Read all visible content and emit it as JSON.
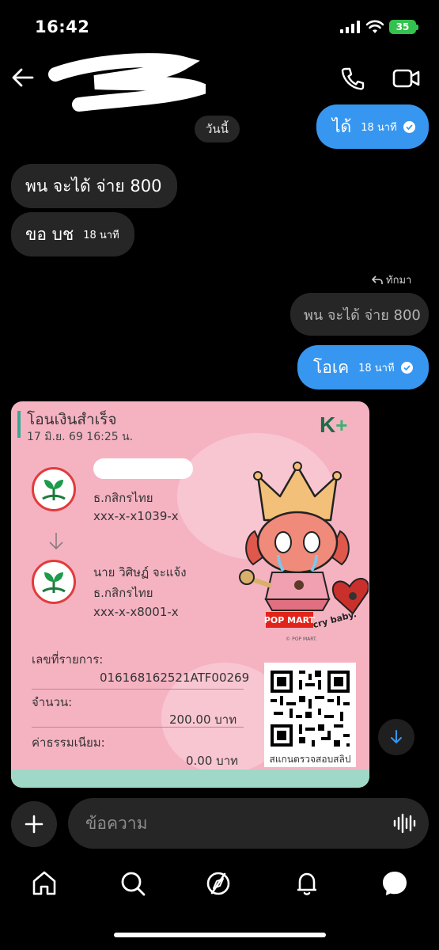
{
  "status_bar": {
    "time": "16:42",
    "battery": "35"
  },
  "header": {},
  "thread": {
    "outgoing_1": {
      "text": "ได้",
      "time": "18 นาที"
    },
    "day_separator": "วันนี้",
    "incoming_1": {
      "text": "พน จะได้ จ่าย 800"
    },
    "incoming_2": {
      "text": "ขอ บช",
      "time": "18 นาที"
    },
    "reply_label": "ทักมา",
    "quoted": {
      "text": "พน จะได้ จ่าย 800"
    },
    "outgoing_2": {
      "text": "โอเค",
      "time": "18 นาที"
    }
  },
  "slip": {
    "title": "โอนเงินสำเร็จ",
    "date": "17 มิ.ย. 69  16:25 น.",
    "brand": "K",
    "brand_plus": "+",
    "sender": {
      "bank": "ธ.กสิกรไทย",
      "account": "xxx-x-x1039-x"
    },
    "receiver": {
      "name": "นาย วิศิษฏ์ จะแจ้ง",
      "bank": "ธ.กสิกรไทย",
      "account": "xxx-x-x8001-x"
    },
    "ref_label": "เลขที่รายการ:",
    "ref_value": "016168162521ATF00269",
    "amount_label": "จำนวน:",
    "amount_value": "200.00 บาท",
    "fee_label": "ค่าธรรมเนียม:",
    "fee_value": "0.00 บาท",
    "qr_label": "สแกนตรวจสอบสลิป",
    "sticker": {
      "brand": "POP MART",
      "subbrand": "cry baby.",
      "copyright": "© POP MART."
    }
  },
  "composer": {
    "placeholder": "ข้อความ"
  },
  "nav": [
    "home-icon",
    "search-icon",
    "explore-icon",
    "activity-icon",
    "messenger-icon"
  ],
  "colors": {
    "accent": "#3797f0",
    "bubble_in": "#262626",
    "slip_bg": "#f5b3c2",
    "kbank_green": "#1d6b4a"
  }
}
